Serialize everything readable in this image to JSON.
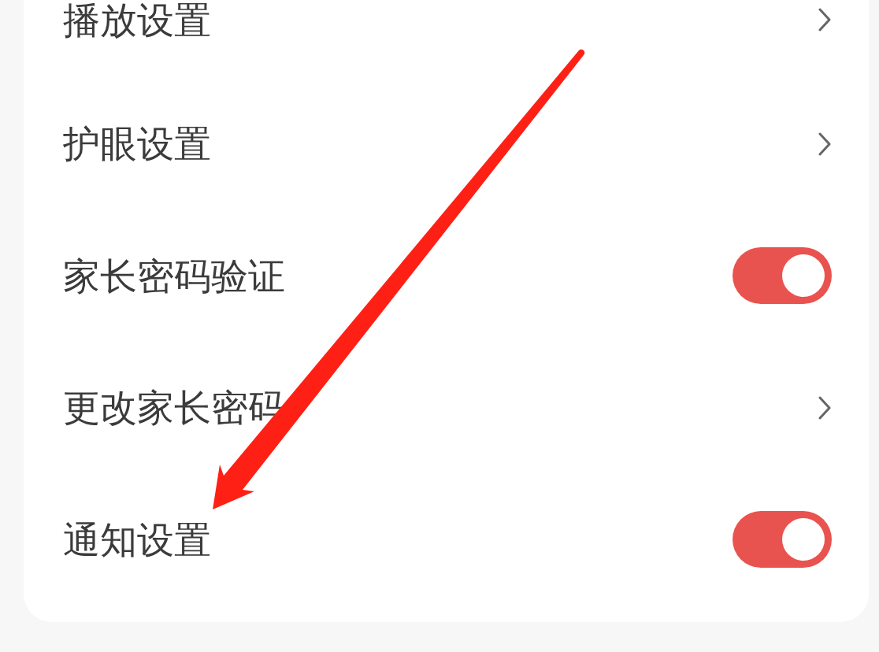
{
  "settings": [
    {
      "label": "播放设置",
      "kind": "link"
    },
    {
      "label": "护眼设置",
      "kind": "link"
    },
    {
      "label": "家长密码验证",
      "kind": "toggle",
      "on": true
    },
    {
      "label": "更改家长密码",
      "kind": "link"
    },
    {
      "label": "通知设置",
      "kind": "toggle",
      "on": true
    }
  ]
}
